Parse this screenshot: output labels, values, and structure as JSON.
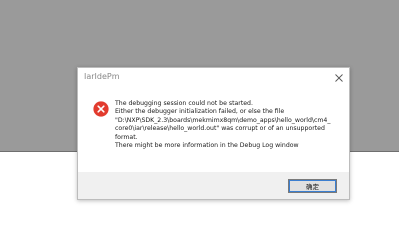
{
  "dialog": {
    "title": "IarIdePm",
    "message_lines": [
      "The debugging session could not be started.",
      "Either the debugger initialization failed, or else the file",
      "\"D:\\NXP\\SDK_2.3\\boards\\mekmimx8qm\\demo_apps\\hello_world\\cm4_",
      "core0\\iar\\release\\hello_world.out\" was corrupt or of an unsupported",
      "format.",
      "There might be more information in the Debug Log window"
    ],
    "ok_label": "确定",
    "icons": {
      "error": "error-icon",
      "close": "close-icon"
    }
  },
  "colors": {
    "backdrop": "#9a9a9a",
    "error_red": "#e23b2e",
    "footer": "#f0f0f0",
    "button_focus": "#3c7fd0"
  }
}
